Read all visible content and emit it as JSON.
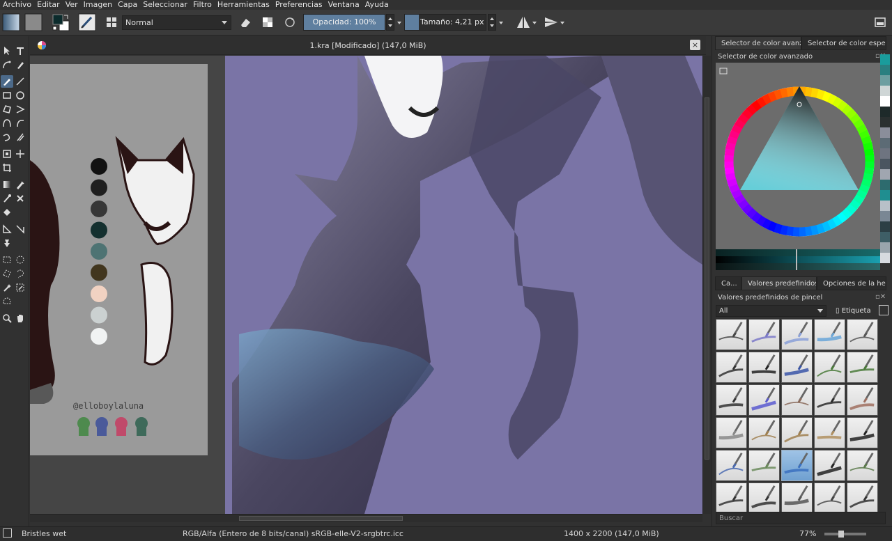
{
  "menu": [
    "Archivo",
    "Editar",
    "Ver",
    "Imagen",
    "Capa",
    "Seleccionar",
    "Filtro",
    "Herramientas",
    "Preferencias",
    "Ventana",
    "Ayuda"
  ],
  "toolbar": {
    "blend_mode": "Normal",
    "opacity": "Opacidad:  100%",
    "size": "Tamaño:  4,21 px"
  },
  "document": {
    "title": "1.kra [Modificado]  (147,0 MiB)",
    "close": "×"
  },
  "reference_sheet": {
    "handle": "@elloboylaluna",
    "palette": [
      "#121212",
      "#1f1f1f",
      "#373737",
      "#14302f",
      "#4e7373",
      "#42361e",
      "#f1d2c2",
      "#cbd1d1",
      "#f1f3f3"
    ]
  },
  "dock": {
    "color_tabs": [
      "Selector de color avanz...",
      "Selector de color especif..."
    ],
    "color_panel_title": "Selector de color avanzado",
    "brush_tabs": [
      "Ca...",
      "Valores predefinidos...",
      "Opciones de la he..."
    ],
    "brush_panel_title": "Valores predefinidos de pincel",
    "brush_filter": "All",
    "tag_label": "Etiqueta",
    "search_placeholder": "Buscar",
    "swatches": [
      "#1a9c9c",
      "#2a7f80",
      "#6d9ea0",
      "#cfd6d6",
      "#ffffff",
      "#1e2a2a",
      "#2a3030",
      "#8a8e9a",
      "#5c6b75",
      "#6e7480",
      "#4a5560",
      "#a0a6b0",
      "#2d6b6e",
      "#1f8e90",
      "#b8c0c8",
      "#7a8794",
      "#2c3f45",
      "#3e5e66",
      "#9aa5ad",
      "#d7dbe0"
    ]
  },
  "status": {
    "brush": "Bristles wet",
    "color_space": "RGB/Alfa (Entero de 8 bits/canal)  sRGB-elle-V2-srgbtrc.icc",
    "dimensions": "1400 x 2200 (147,0 MiB)",
    "zoom": "77%"
  }
}
